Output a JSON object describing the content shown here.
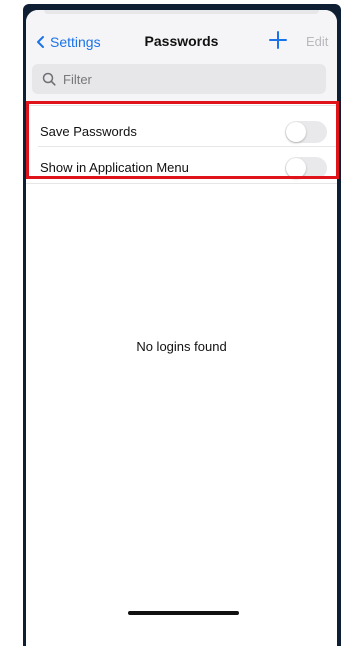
{
  "nav": {
    "back_label": "Settings",
    "title": "Passwords",
    "add_icon": "plus-icon",
    "edit_label": "Edit"
  },
  "search": {
    "placeholder": "Filter",
    "value": ""
  },
  "settings": [
    {
      "label": "Save Passwords",
      "enabled": false
    },
    {
      "label": "Show in Application Menu",
      "enabled": false
    }
  ],
  "empty_state": "No logins found",
  "colors": {
    "accent": "#1a73e8",
    "highlight": "#e0131a",
    "disabled_text": "#b7b9bd",
    "toggle_off": "#e9e9eb"
  }
}
